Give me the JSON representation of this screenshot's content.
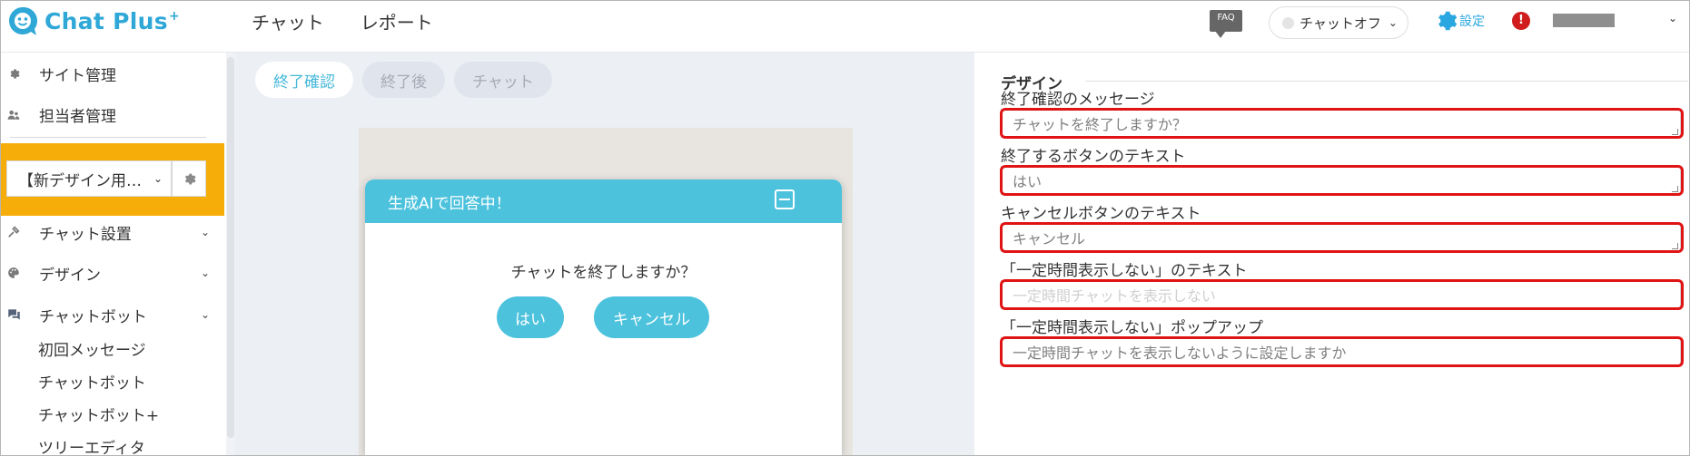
{
  "header": {
    "logo_text": "Chat Plus",
    "logo_sup": "+",
    "nav": [
      "チャット",
      "レポート"
    ],
    "faq_label": "FAQ",
    "chat_status": "チャットオフ",
    "settings_label": "設定",
    "alert_mark": "!"
  },
  "sidebar": {
    "site_admin": "サイト管理",
    "staff_admin": "担当者管理",
    "site_select": "【新デザイン用…",
    "menus": [
      "チャット設置",
      "デザイン",
      "チャットボット"
    ],
    "submenus": [
      "初回メッセージ",
      "チャットボット",
      "チャットボット+",
      "ツリーエディタ"
    ]
  },
  "tabs": [
    {
      "label": "終了確認",
      "active": true
    },
    {
      "label": "終了後",
      "active": false
    },
    {
      "label": "チャット",
      "active": false
    }
  ],
  "widget": {
    "header_title": "生成AIで回答中！",
    "question": "チャットを終了しますか？",
    "yes_label": "はい",
    "cancel_label": "キャンセル"
  },
  "form": {
    "section_title": "デザイン",
    "fields": [
      {
        "label": "終了確認のメッセージ",
        "value": "チャットを終了しますか？",
        "placeholder": false
      },
      {
        "label": "終了するボタンのテキスト",
        "value": "はい",
        "placeholder": false
      },
      {
        "label": "キャンセルボタンのテキスト",
        "value": "キャンセル",
        "placeholder": false
      },
      {
        "label": "「一定時間表示しない」のテキスト",
        "value": "一定時間チャットを表示しない",
        "placeholder": true
      },
      {
        "label": "「一定時間表示しない」ポップアップ",
        "value": "一定時間チャットを表示しないように設定しますか",
        "placeholder": false
      }
    ]
  },
  "colors": {
    "brand": "#2fa8d8",
    "widget_accent": "#4cc2dd",
    "highlight_orange": "#f6ad09",
    "highlight_red": "#e01414"
  }
}
